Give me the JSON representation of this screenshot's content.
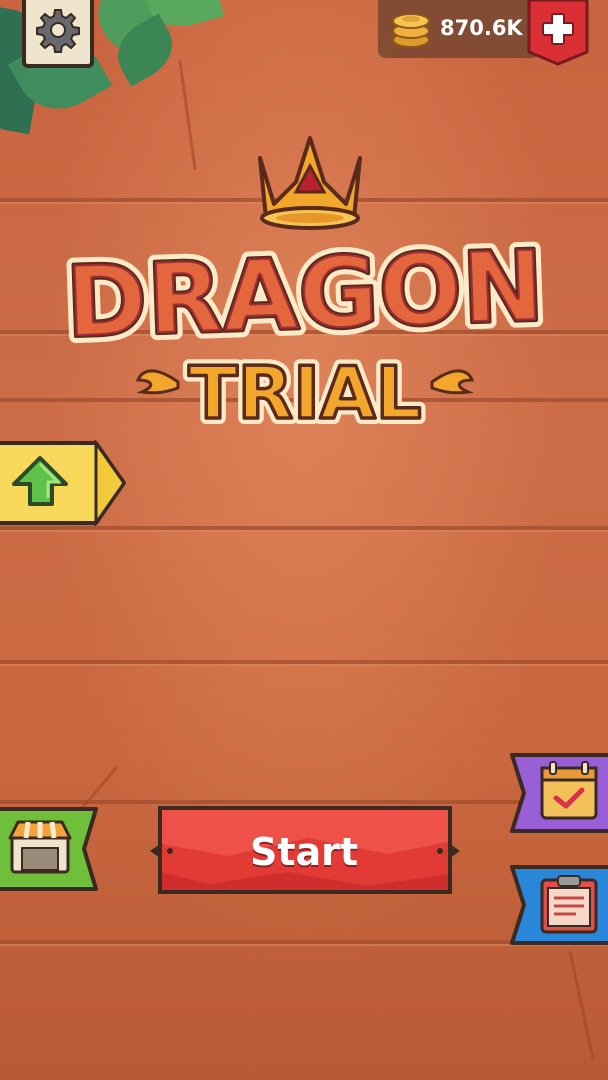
{
  "title": {
    "line1": "DRAGON",
    "line2": "TRIAL"
  },
  "header": {
    "coins_value": "870.6K",
    "settings_icon": "gear-icon",
    "coins_icon": "coin-stack-icon",
    "add_icon": "plus-icon"
  },
  "buttons": {
    "start_label": "Start",
    "upgrade_icon": "up-arrow-icon",
    "shop_icon": "shop-icon",
    "daily_icon": "calendar-check-icon",
    "tasks_icon": "clipboard-icon"
  },
  "colors": {
    "background": "#c96a45",
    "start_button": "#e23b35",
    "upgrade_tab": "#f7d85a",
    "shop_tab": "#6fbf3a",
    "daily_tab": "#9a5fd6",
    "tasks_tab": "#2a86d8",
    "add_button": "#d92f35",
    "title_gold": "#f2a72c",
    "title_red": "#d8314a"
  }
}
